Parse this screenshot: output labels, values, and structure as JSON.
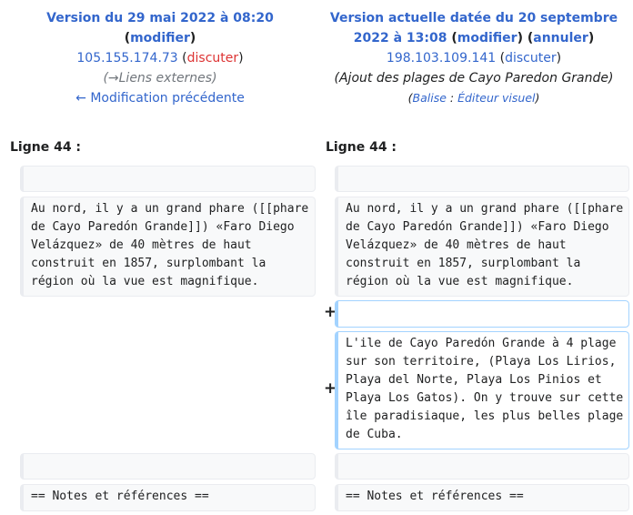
{
  "left": {
    "title_line1": "Version du 29 mai 2022 à 08:20",
    "modify": "modifier",
    "user": "105.155.174.73",
    "talk": "discuter",
    "summary": "(→Liens externes)",
    "prev": "← Modification précédente"
  },
  "right": {
    "title_line1": "Version actuelle datée du 20 septembre",
    "title_line2": "2022 à 13:08",
    "modify": "modifier",
    "undo": "annuler",
    "user": "198.103.109.141",
    "talk": "discuter",
    "summary": "(Ajout des plages de Cayo Paredon Grande)",
    "tag_label": "Balise",
    "tag_value": "Éditeur visuel"
  },
  "diff": {
    "line_label": "Ligne 44 :",
    "context_text": "Au nord, il y a un grand phare ([[phare de Cayo Paredón Grande]]) «Faro Diego Velázquez» de 40 mètres de haut construit en 1857, surplombant la région où la vue est magnifique.",
    "added_text": "L'ile de Cayo Paredón Grande à 4 plage sur son territoire, (Playa Los Lirios, Playa del Norte, Playa Los Pinios et Playa Los Gatos). On y trouve sur cette île paradisiaque, les plus belles plage de Cuba.",
    "notes_text": "== Notes et références ==",
    "plus": "+"
  }
}
